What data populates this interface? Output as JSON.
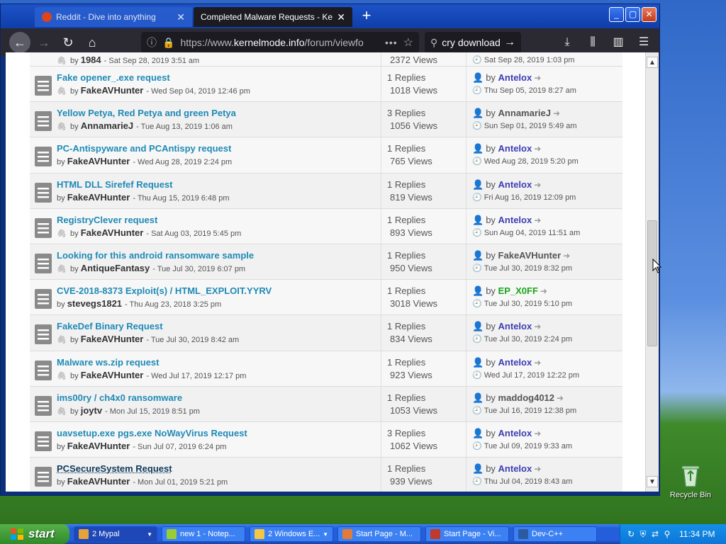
{
  "browser": {
    "tabs": [
      {
        "title": "Reddit - Dive into anything",
        "active": false,
        "favicon_color": "#ff4500"
      },
      {
        "title": "Completed Malware Requests - KernelM",
        "active": true,
        "favicon_color": ""
      }
    ],
    "url_prefix": "https://www.",
    "url_domain": "kernelmode.info",
    "url_suffix": "/forum/viewfo",
    "search_value": "cry download"
  },
  "topics": [
    {
      "title": "Fake opener_.exe request",
      "has_attachment": true,
      "author": "FakeAVHunter",
      "date": "- Wed Sep 04, 2019 12:46 pm",
      "replies": "1 Replies",
      "views": "1018 Views",
      "last_by": "Antelox",
      "last_style": "blue",
      "last_date": "Thu Sep 05, 2019 8:27 am"
    },
    {
      "title": "Yellow Petya, Red Petya and green Petya",
      "has_attachment": true,
      "author": "AnnamarieJ",
      "date": "- Tue Aug 13, 2019 1:06 am",
      "replies": "3 Replies",
      "views": "1056 Views",
      "last_by": "AnnamarieJ",
      "last_style": "plain",
      "last_date": "Sun Sep 01, 2019 5:49 am"
    },
    {
      "title": "PC-Antispyware and PCAntispy request",
      "has_attachment": false,
      "author": "FakeAVHunter",
      "date": "- Wed Aug 28, 2019 2:24 pm",
      "replies": "1 Replies",
      "views": "765 Views",
      "last_by": "Antelox",
      "last_style": "blue",
      "last_date": "Wed Aug 28, 2019 5:20 pm"
    },
    {
      "title": "HTML DLL Sirefef Request",
      "has_attachment": false,
      "author": "FakeAVHunter",
      "date": "- Thu Aug 15, 2019 6:48 pm",
      "replies": "1 Replies",
      "views": "819 Views",
      "last_by": "Antelox",
      "last_style": "blue",
      "last_date": "Fri Aug 16, 2019 12:09 pm"
    },
    {
      "title": "RegistryClever request",
      "has_attachment": true,
      "author": "FakeAVHunter",
      "date": "- Sat Aug 03, 2019 5:45 pm",
      "replies": "1 Replies",
      "views": "893 Views",
      "last_by": "Antelox",
      "last_style": "blue",
      "last_date": "Sun Aug 04, 2019 11:51 am"
    },
    {
      "title": "Looking for this android ransomware sample",
      "has_attachment": true,
      "author": "AntiqueFantasy",
      "date": "- Tue Jul 30, 2019 6:07 pm",
      "replies": "1 Replies",
      "views": "950 Views",
      "last_by": "FakeAVHunter",
      "last_style": "plain",
      "last_date": "Tue Jul 30, 2019 8:32 pm"
    },
    {
      "title": "CVE-2018-8373 Exploit(s) / HTML_EXPLOIT.YYRV",
      "has_attachment": false,
      "author": "stevegs1821",
      "date": "- Thu Aug 23, 2018 3:25 pm",
      "replies": "1 Replies",
      "views": "3018 Views",
      "last_by": "EP_X0FF",
      "last_style": "green",
      "last_date": "Tue Jul 30, 2019 5:10 pm"
    },
    {
      "title": "FakeDef Binary Request",
      "has_attachment": true,
      "author": "FakeAVHunter",
      "date": "- Tue Jul 30, 2019 8:42 am",
      "replies": "1 Replies",
      "views": "834 Views",
      "last_by": "Antelox",
      "last_style": "blue",
      "last_date": "Tue Jul 30, 2019 2:24 pm"
    },
    {
      "title": "Malware ws.zip request",
      "has_attachment": true,
      "author": "FakeAVHunter",
      "date": "- Wed Jul 17, 2019 12:17 pm",
      "replies": "1 Replies",
      "views": "923 Views",
      "last_by": "Antelox",
      "last_style": "blue",
      "last_date": "Wed Jul 17, 2019 12:22 pm"
    },
    {
      "title": "ims00ry / ch4x0 ransomware",
      "has_attachment": true,
      "author": "joytv",
      "date": "- Mon Jul 15, 2019 8:51 pm",
      "replies": "1 Replies",
      "views": "1053 Views",
      "last_by": "maddog4012",
      "last_style": "plain",
      "last_date": "Tue Jul 16, 2019 12:38 pm"
    },
    {
      "title": "uavsetup.exe pgs.exe NoWayVirus Request",
      "has_attachment": false,
      "author": "FakeAVHunter",
      "date": "- Sun Jul 07, 2019 6:24 pm",
      "replies": "3 Replies",
      "views": "1062 Views",
      "last_by": "Antelox",
      "last_style": "blue",
      "last_date": "Tue Jul 09, 2019 9:33 am"
    },
    {
      "title": "PCSecureSystem Request",
      "has_attachment": false,
      "author": "FakeAVHunter",
      "date": "- Mon Jul 01, 2019 5:21 pm",
      "replies": "1 Replies",
      "views": "939 Views",
      "last_by": "Antelox",
      "last_style": "blue",
      "last_date": "Thu Jul 04, 2019 8:43 am",
      "visited": true
    }
  ],
  "top_partial": {
    "author": "1984",
    "date": "- Sat Sep 28, 2019 3:51 am",
    "views": "2372 Views",
    "last_date": "Sat Sep 28, 2019 1:03 pm"
  },
  "by_label": "by",
  "desktop": {
    "recycle_bin": "Recycle Bin"
  },
  "taskbar": {
    "start_label": "start",
    "items": [
      {
        "label": "2 Mypal",
        "active": true,
        "icon_color": "#e6a23c",
        "group": true
      },
      {
        "label": "new 1 - Notep...",
        "active": false,
        "icon_color": "#9acd32",
        "group": false
      },
      {
        "label": "2 Windows E...",
        "active": false,
        "icon_color": "#f3c744",
        "group": true
      },
      {
        "label": "Start Page - M...",
        "active": false,
        "icon_color": "#e07b39",
        "group": false
      },
      {
        "label": "Start Page - Vi...",
        "active": false,
        "icon_color": "#c0392b",
        "group": false
      },
      {
        "label": "Dev-C++",
        "active": false,
        "icon_color": "#2c5aa0",
        "group": false
      }
    ],
    "clock": "11:34 PM"
  }
}
